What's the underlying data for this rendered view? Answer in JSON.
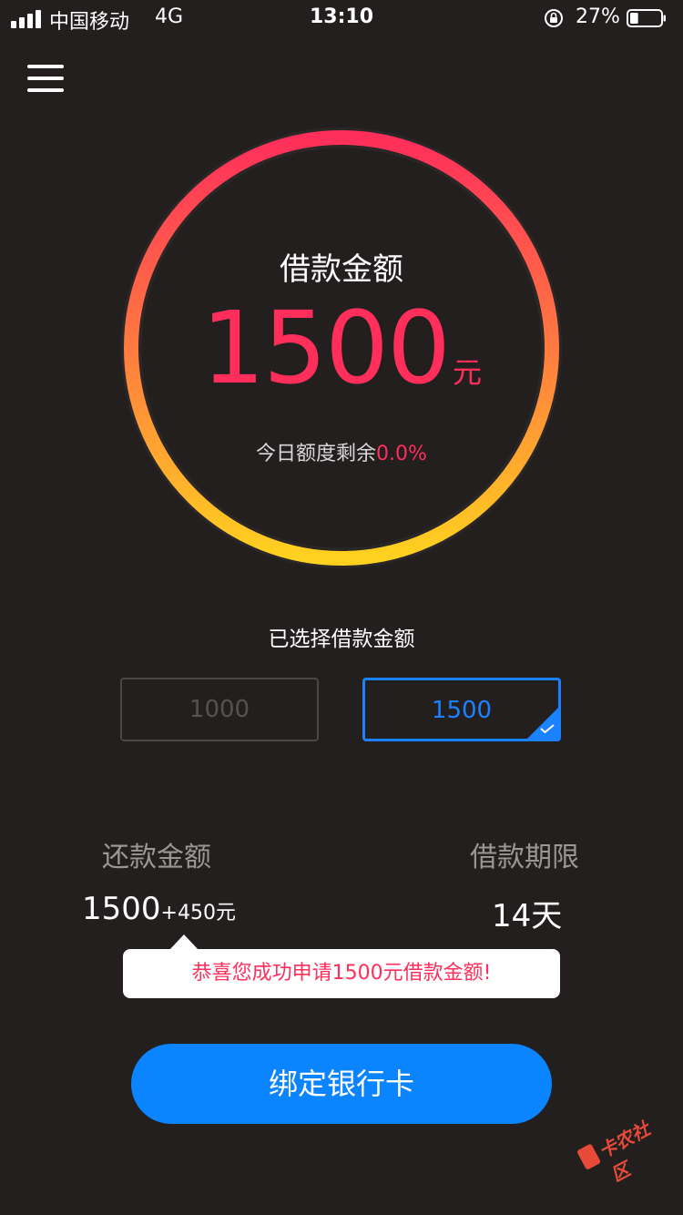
{
  "status_bar": {
    "carrier": "中国移动",
    "network": "4G",
    "time": "13:10",
    "battery": "27%",
    "battery_level": 0.27
  },
  "gauge": {
    "title": "借款金额",
    "amount": "1500",
    "unit": "元",
    "remaining_label": "今日额度剩余",
    "remaining_value": "0.0%",
    "colors": {
      "start": "#ff2e5b",
      "end": "#ffd21f"
    }
  },
  "selection": {
    "label": "已选择借款金额",
    "options": [
      {
        "label": "1000",
        "selected": false
      },
      {
        "label": "1500",
        "selected": true
      }
    ],
    "accent": "#1a82ff"
  },
  "repayment": {
    "label": "还款金额",
    "base": "1500",
    "extra": "+450元"
  },
  "term": {
    "label": "借款期限",
    "value": "14天"
  },
  "tooltip": {
    "text": "恭喜您成功申请1500元借款金额!"
  },
  "cta": {
    "label": "绑定银行卡",
    "color": "#0a84ff"
  },
  "watermark": {
    "text": "卡农社区",
    "icon": "kanong-logo-icon"
  }
}
